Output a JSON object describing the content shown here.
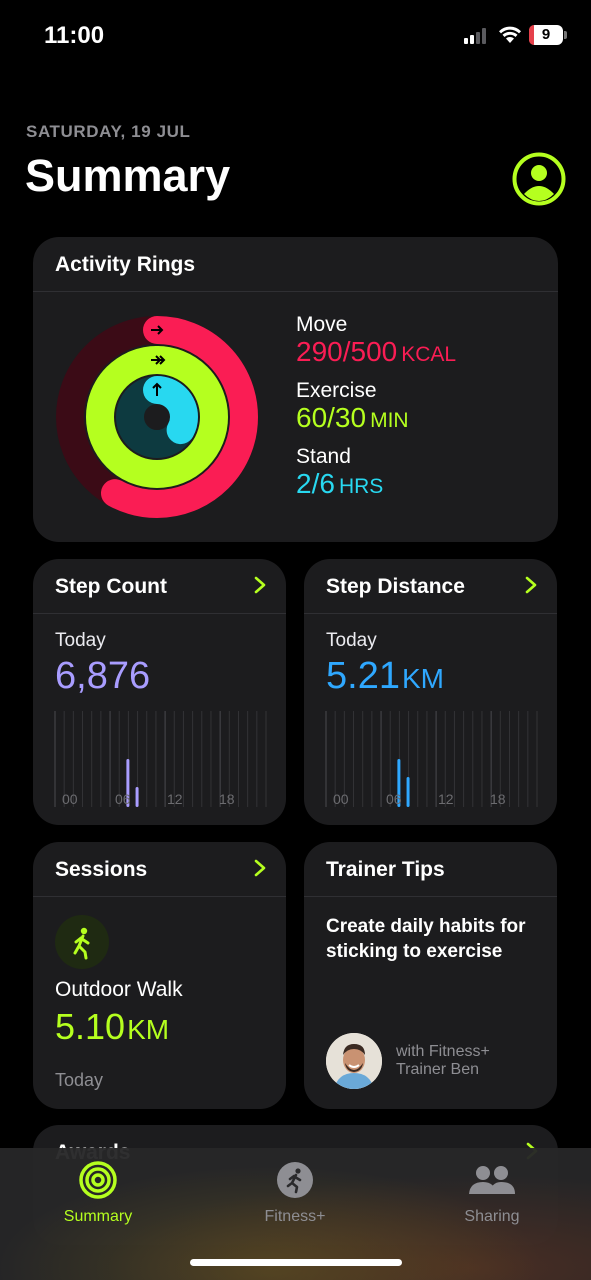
{
  "status_bar": {
    "time": "11:00",
    "battery": "9"
  },
  "header": {
    "date": "SATURDAY, 19 JUL",
    "title": "Summary"
  },
  "activity_rings": {
    "title": "Activity Rings",
    "move": {
      "label": "Move",
      "value": "290/500",
      "unit": "KCAL",
      "progress": 0.58,
      "color": "#fa1d54"
    },
    "exercise": {
      "label": "Exercise",
      "value": "60/30",
      "unit": "MIN",
      "progress": 2.0,
      "color": "#b5ff1f"
    },
    "stand": {
      "label": "Stand",
      "value": "2/6",
      "unit": "HRS",
      "progress": 0.33,
      "color": "#28d8f0"
    }
  },
  "step_count": {
    "title": "Step Count",
    "today_label": "Today",
    "value": "6,876",
    "ticks": [
      "00",
      "06",
      "12",
      "18"
    ],
    "color": "#a99dff"
  },
  "step_distance": {
    "title": "Step Distance",
    "today_label": "Today",
    "value": "5.21",
    "unit": "KM",
    "ticks": [
      "00",
      "06",
      "12",
      "18"
    ],
    "color": "#2fa8ff"
  },
  "sessions": {
    "title": "Sessions",
    "workout": "Outdoor Walk",
    "value": "5.10",
    "unit": "KM",
    "when": "Today"
  },
  "trainer_tips": {
    "title": "Trainer Tips",
    "text": "Create daily habits for sticking to exercise",
    "trainer_line1": "with Fitness+",
    "trainer_line2": "Trainer Ben"
  },
  "awards": {
    "title": "Awards"
  },
  "tabs": [
    {
      "label": "Summary",
      "icon": "activity-rings-icon",
      "active": true
    },
    {
      "label": "Fitness+",
      "icon": "fitness-plus-icon",
      "active": false
    },
    {
      "label": "Sharing",
      "icon": "sharing-people-icon",
      "active": false
    }
  ],
  "colors": {
    "accent": "#b5ff1f",
    "card": "#1c1c1e",
    "background": "#000000"
  }
}
